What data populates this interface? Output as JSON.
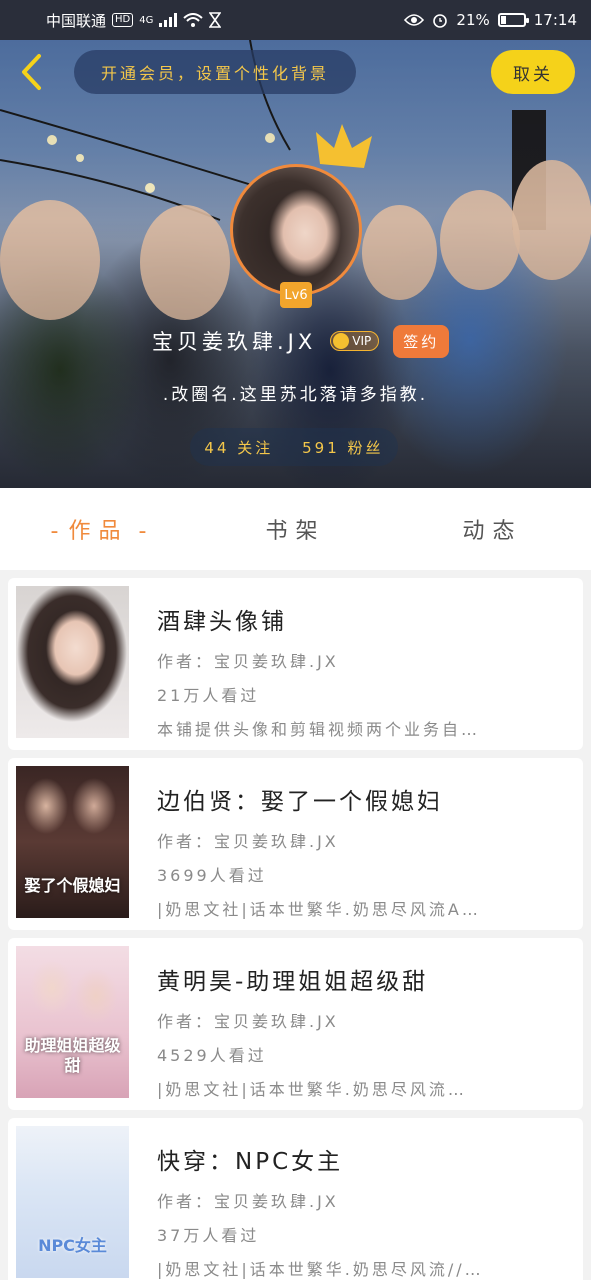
{
  "status_bar": {
    "carrier": "中国联通",
    "hd": "HD",
    "network": "4G",
    "battery_percent": "21%",
    "battery_level": 0.21,
    "time": "17:14"
  },
  "header": {
    "notice": "开通会员，设置个性化背景",
    "cancel_label": "取关"
  },
  "profile": {
    "level": "Lv6",
    "username": "宝贝姜玖肆.JX",
    "vip_label": "VIP",
    "signed_label": "签约",
    "bio": ".改圈名.这里苏北落请多指教.",
    "following": "44 关注",
    "followers": "591 粉丝"
  },
  "tabs": [
    {
      "label": "作品",
      "active": true
    },
    {
      "label": "书架",
      "active": false
    },
    {
      "label": "动态",
      "active": false
    }
  ],
  "works": [
    {
      "title": "酒肆头像铺",
      "author": "作者：宝贝姜玖肆.JX",
      "views": "21万人看过",
      "desc": "本铺提供头像和剪辑视频两个业务自…",
      "cover_text": ""
    },
    {
      "title": "边伯贤：娶了一个假媳妇",
      "author": "作者：宝贝姜玖肆.JX",
      "views": "3699人看过",
      "desc": "|奶思文社|话本世繁华.奶思尽风流A…",
      "cover_text": "娶了个假媳妇"
    },
    {
      "title": "黄明昊-助理姐姐超级甜",
      "author": "作者：宝贝姜玖肆.JX",
      "views": "4529人看过",
      "desc": "|奶思文社|话本世繁华.奶思尽风流…",
      "cover_text": "助理姐姐超级甜"
    },
    {
      "title": "快穿：NPC女主",
      "author": "作者：宝贝姜玖肆.JX",
      "views": "37万人看过",
      "desc": "|奶思文社|话本世繁华.奶思尽风流//…",
      "cover_text": "NPC女主"
    }
  ],
  "colors": {
    "accent": "#f08a3c",
    "gold": "#f4c74a",
    "cancel_bg": "#f5d21a"
  }
}
